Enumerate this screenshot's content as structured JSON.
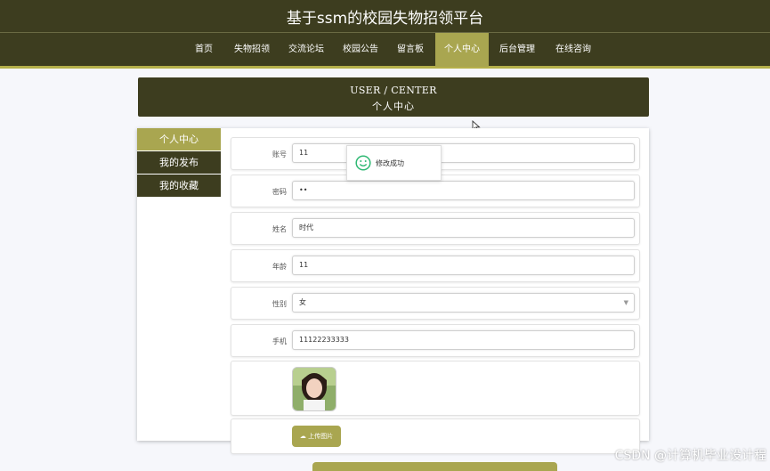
{
  "site": {
    "title": "基于ssm的校园失物招领平台"
  },
  "nav": {
    "items": [
      {
        "label": "首页"
      },
      {
        "label": "失物招领"
      },
      {
        "label": "交流论坛"
      },
      {
        "label": "校园公告"
      },
      {
        "label": "留言板"
      },
      {
        "label": "个人中心"
      },
      {
        "label": "后台管理"
      },
      {
        "label": "在线咨询"
      }
    ],
    "active": "个人中心"
  },
  "header": {
    "title_en": "USER / CENTER",
    "title_zh": "个人中心"
  },
  "sidebar": {
    "items": [
      {
        "label": "个人中心"
      },
      {
        "label": "我的发布"
      },
      {
        "label": "我的收藏"
      }
    ],
    "active": "个人中心"
  },
  "form": {
    "account": {
      "label": "账号",
      "value": "11"
    },
    "password": {
      "label": "密码",
      "value": "••"
    },
    "name": {
      "label": "姓名",
      "value": "时代"
    },
    "age": {
      "label": "年龄",
      "value": "11"
    },
    "gender": {
      "label": "性别",
      "value": "女"
    },
    "phone": {
      "label": "手机",
      "value": "11122233333"
    },
    "upload": {
      "label": "上传图片"
    }
  },
  "toast": {
    "text": "修改成功"
  },
  "watermark": "CSDN @计算机毕业设计程",
  "colors": {
    "dark": "#3d3d1f",
    "accent": "#a9a650"
  }
}
